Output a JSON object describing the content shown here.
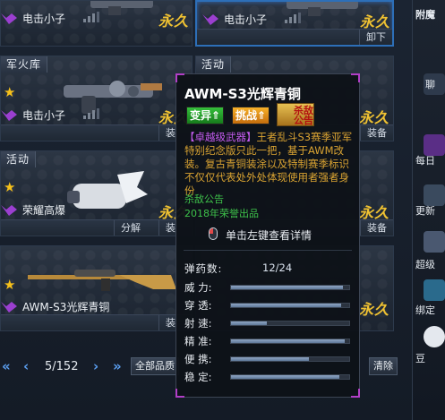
{
  "inventory": {
    "cards": [
      {
        "id": "c1",
        "name": "电击小子",
        "status": "永久",
        "actions": []
      },
      {
        "id": "c2",
        "name": "电击小子",
        "status": "永久",
        "actions": [
          "卸下"
        ]
      },
      {
        "id": "c3",
        "tag": "军火库",
        "name": "电击小子",
        "status": "永久",
        "actions": []
      },
      {
        "id": "c4",
        "tag": "活动",
        "name": "",
        "status": "永久",
        "actions": [
          "装备"
        ]
      },
      {
        "id": "c5",
        "tag": "活动",
        "name": "荣耀高爆",
        "status": "永久",
        "actions": [
          "分解"
        ]
      },
      {
        "id": "c6",
        "name": "",
        "status": "永久",
        "actions": [
          "装备"
        ]
      },
      {
        "id": "c7",
        "name": "AWM-S3光辉青铜",
        "status": "",
        "actions": []
      },
      {
        "id": "c8",
        "name": "",
        "status": "永久",
        "actions": []
      }
    ],
    "partial_actions": {
      "c3": "装",
      "c5": "装",
      "c7": "装"
    }
  },
  "pager": {
    "prev_double": "«",
    "prev": "‹",
    "page_text": "5/152",
    "next": "›",
    "next_double": "»",
    "filter_label": "全部品质",
    "clear_label": "清除"
  },
  "side": {
    "top_label": "附魔",
    "items": [
      "聊",
      "每日",
      "更新",
      "超级",
      "绑定",
      "豆"
    ]
  },
  "tooltip": {
    "title": "AWM-S3光辉青铜",
    "badges": [
      "变异",
      "挑战",
      "杀敌公告"
    ],
    "desc_tag": "【卓越级武器】",
    "desc_body": "王者乱斗S3赛季亚军特别纪念版只此一把，基于AWM改装。复古青铜装涂以及特制赛季标识不仅仅代表处外处体现使用者强者身份",
    "note1": "杀敌公告",
    "note2": "2018年荣誉出品",
    "click_hint": "单击左键查看详情",
    "ammo_label": "弹药数:",
    "ammo_value": "12/24",
    "stats": [
      {
        "label": "威  力:",
        "value": 0.95
      },
      {
        "label": "穿  透:",
        "value": 0.93
      },
      {
        "label": "射  速:",
        "value": 0.3
      },
      {
        "label": "精  准:",
        "value": 0.96
      },
      {
        "label": "便  携:",
        "value": 0.66
      },
      {
        "label": "稳  定:",
        "value": 0.92
      }
    ]
  },
  "colors": {
    "accent_blue": "#2d6fb8",
    "permanent_gold": "#f0c232",
    "tooltip_purple": "#b13fc6",
    "note_green": "#3ec24a"
  }
}
